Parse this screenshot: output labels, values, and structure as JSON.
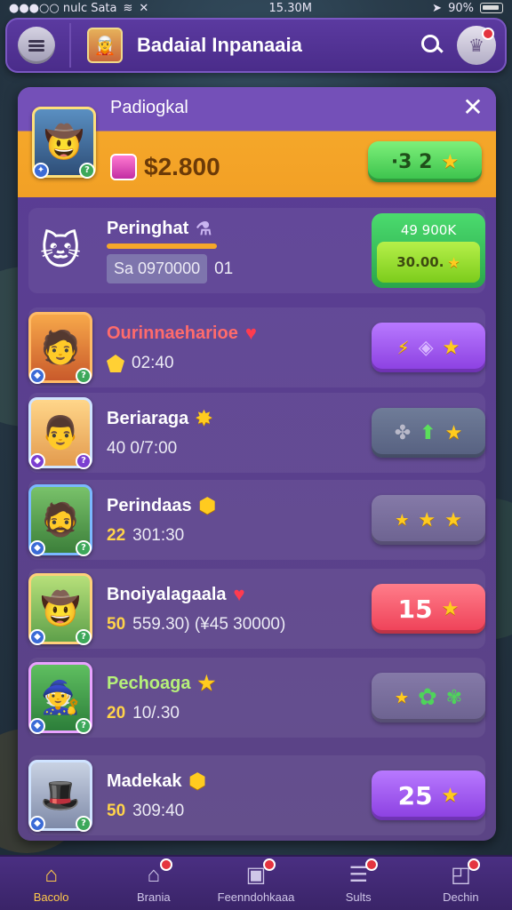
{
  "status_bar": {
    "carrier": "●●●○○ nulc Sata",
    "time": "15.30M",
    "battery": "90%"
  },
  "header": {
    "title": "Badaial Inpanaaia"
  },
  "panel": {
    "featured": {
      "name": "Padiogkal",
      "balance": "$2.800",
      "action_label": "·3 2"
    },
    "rows": [
      {
        "name": "Peringhat",
        "value": "Sa 0970000",
        "extra": "01",
        "button_top": "49 900K",
        "button_bottom": "30.00."
      },
      {
        "name": "Ourinnaeharioe",
        "value": "02:40"
      },
      {
        "name": "Beriaraga",
        "value": "40  0/7:00"
      },
      {
        "name": "Perindaas",
        "value_num": "22",
        "value": "301:30"
      },
      {
        "name": "Bnoiyalagaala",
        "value_num": "50",
        "value": "559.30) (¥45 30000)",
        "action_label": "15"
      },
      {
        "name": "Pechoaga",
        "value_num": "20",
        "value": "10/.30"
      },
      {
        "name": "Madekak",
        "value_num": "50",
        "value": "309:40",
        "action_label": "25"
      }
    ]
  },
  "tabs": [
    {
      "label": "Bacolo",
      "icon": "home-icon"
    },
    {
      "label": "Brania",
      "icon": "house-icon"
    },
    {
      "label": "Feenndohkaaa",
      "icon": "cards-icon"
    },
    {
      "label": "Sults",
      "icon": "list-icon"
    },
    {
      "label": "Dechin",
      "icon": "profile-icon"
    }
  ],
  "colors": {
    "accent_gold": "#f5a72a",
    "panel_purple": "#5a3d94",
    "active_tab": "#ffc94a",
    "alert_red": "#e4343f"
  }
}
